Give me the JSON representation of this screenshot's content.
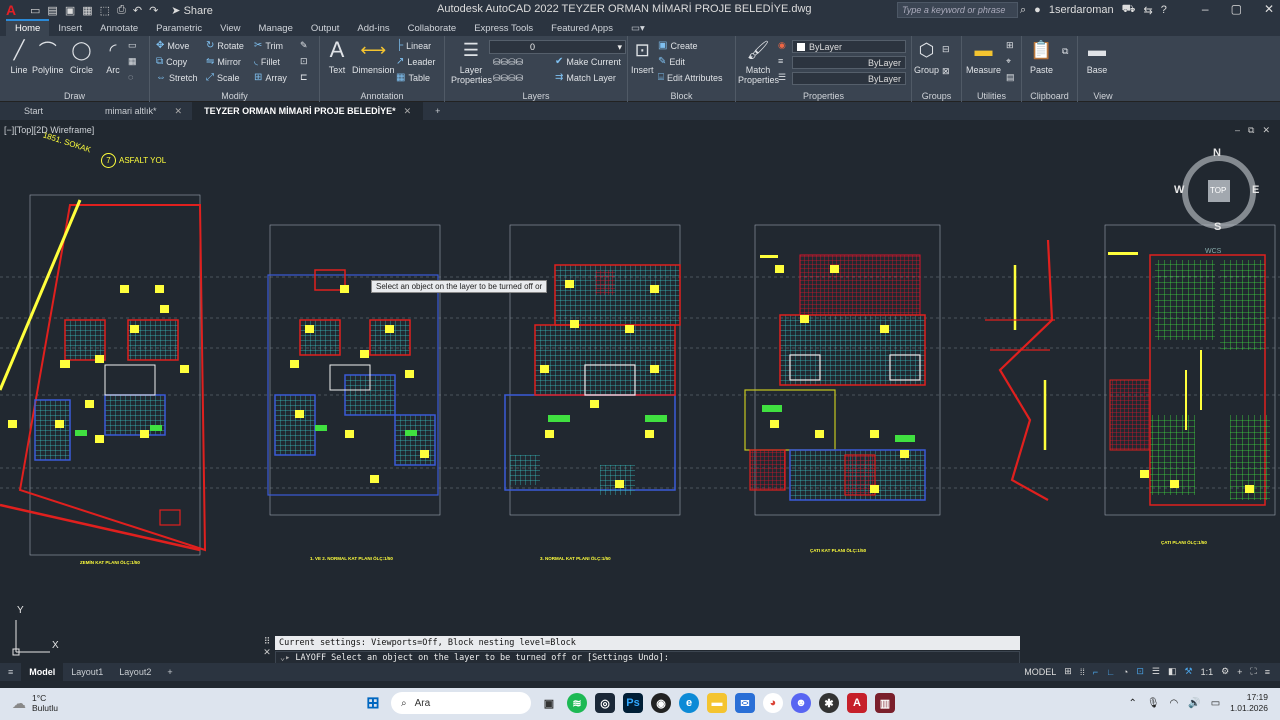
{
  "titlebar": {
    "share": "Share",
    "title": "Autodesk AutoCAD 2022   TEYZER ORMAN MİMARİ PROJE BELEDİYE.dwg",
    "search_placeholder": "Type a keyword or phrase",
    "user": "1serdaroman"
  },
  "ribbon_tabs": [
    "Home",
    "Insert",
    "Annotate",
    "Parametric",
    "View",
    "Manage",
    "Output",
    "Add-ins",
    "Collaborate",
    "Express Tools",
    "Featured Apps"
  ],
  "panels": {
    "draw": {
      "title": "Draw",
      "tools": [
        "Line",
        "Polyline",
        "Circle",
        "Arc"
      ]
    },
    "modify": {
      "title": "Modify",
      "tools": [
        "Move",
        "Rotate",
        "Trim",
        "Copy",
        "Mirror",
        "Fillet",
        "Stretch",
        "Scale",
        "Array"
      ]
    },
    "annotation": {
      "title": "Annotation",
      "tools": [
        "Text",
        "Dimension",
        "Linear",
        "Leader",
        "Table"
      ]
    },
    "layers": {
      "title": "Layers",
      "big": "Layer Properties",
      "current_layer": "0",
      "tools": [
        "Make Current",
        "Match Layer"
      ]
    },
    "block": {
      "title": "Block",
      "big": "Insert",
      "tools": [
        "Create",
        "Edit",
        "Edit Attributes"
      ]
    },
    "properties": {
      "title": "Properties",
      "big": "Match Properties",
      "color": "ByLayer",
      "linetype": "ByLayer",
      "lineweight": "ByLayer"
    },
    "groups": {
      "title": "Groups",
      "big": "Group"
    },
    "utilities": {
      "title": "Utilities",
      "big": "Measure"
    },
    "clipboard": {
      "title": "Clipboard",
      "big": "Paste"
    },
    "view": {
      "title": "View",
      "big": "Base"
    }
  },
  "doc_tabs": [
    {
      "label": "Start"
    },
    {
      "label": "mimari altlık*"
    },
    {
      "label": "TEYZER ORMAN MİMARİ PROJE BELEDİYE*"
    }
  ],
  "viewport": {
    "label": "[−][Top][2D Wireframe]",
    "viewcube": {
      "n": "N",
      "s": "S",
      "e": "E",
      "w": "W",
      "face": "TOP",
      "wcs": "WCS"
    },
    "tooltip": "Select an object on the layer to be turned off or",
    "street_labels": [
      "1851. SOKAK",
      "ASFALT YOL",
      "7"
    ],
    "plan_titles": [
      "ZEMİN KAT PLANI ÖLÇ:1/50",
      "1. VE 2. NORMAL KAT PLANI ÖLÇ:1/50",
      "3. NORMAL KAT PLANI ÖLÇ:1/50",
      "ÇATI KAT PLANI ÖLÇ:1/50",
      "ÇATI PLANI ÖLÇ:1/50"
    ],
    "ucs": {
      "x": "X",
      "y": "Y"
    }
  },
  "command": {
    "history": "Current settings: Viewports=Off, Block nesting level=Block",
    "prompt": "LAYOFF Select an object on the layer to be turned off or [Settings Undo]:"
  },
  "layout_tabs": [
    "Model",
    "Layout1",
    "Layout2"
  ],
  "status": {
    "mode": "MODEL",
    "scale": "1:1"
  },
  "taskbar": {
    "temperature": "1°C",
    "weather": "Bulutlu",
    "search": "Ara",
    "time": "17:19",
    "date": "1.01.2026"
  },
  "colors": {
    "accent": "#2b8ad8",
    "background": "#212830",
    "ribbon": "#3a4451",
    "cad_yellow": "#ffff3c",
    "cad_red": "#e0201e",
    "cad_cyan": "#37c8c8"
  }
}
